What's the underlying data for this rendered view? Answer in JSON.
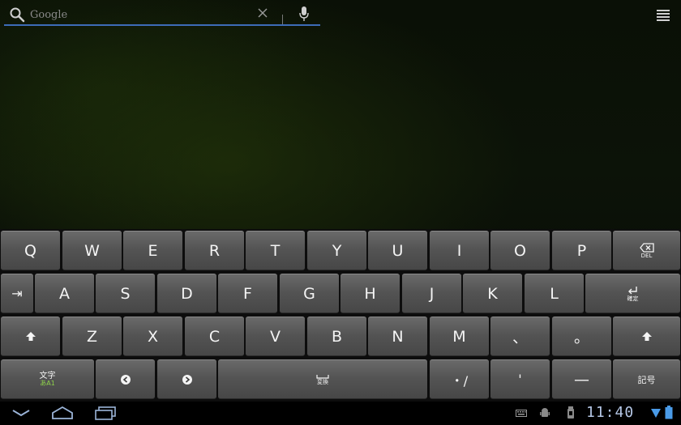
{
  "search": {
    "placeholder": "Google",
    "value": ""
  },
  "keyboard": {
    "row1": [
      "Q",
      "W",
      "E",
      "R",
      "T",
      "Y",
      "U",
      "I",
      "O",
      "P"
    ],
    "delete_label": "DEL",
    "tab_label": "⇥",
    "row2": [
      "A",
      "S",
      "D",
      "F",
      "G",
      "H",
      "J",
      "K",
      "L"
    ],
    "enter_label": "確定",
    "row3": [
      "Z",
      "X",
      "C",
      "V",
      "B",
      "N",
      "M",
      "、",
      "。"
    ],
    "mode_label": "文字",
    "mode_sub": "あA1",
    "space_label": "変換",
    "dot_slash": "・/",
    "apostrophe": "'",
    "long_dash": "—",
    "symbols_label": "記号"
  },
  "status_bar": {
    "clock": "11:40"
  },
  "colors": {
    "accent": "#3d6cb8",
    "key_top": "#6a6a6a",
    "key_bottom": "#474747",
    "clock": "#b5c7e6",
    "mode_green": "#8ed24a"
  }
}
